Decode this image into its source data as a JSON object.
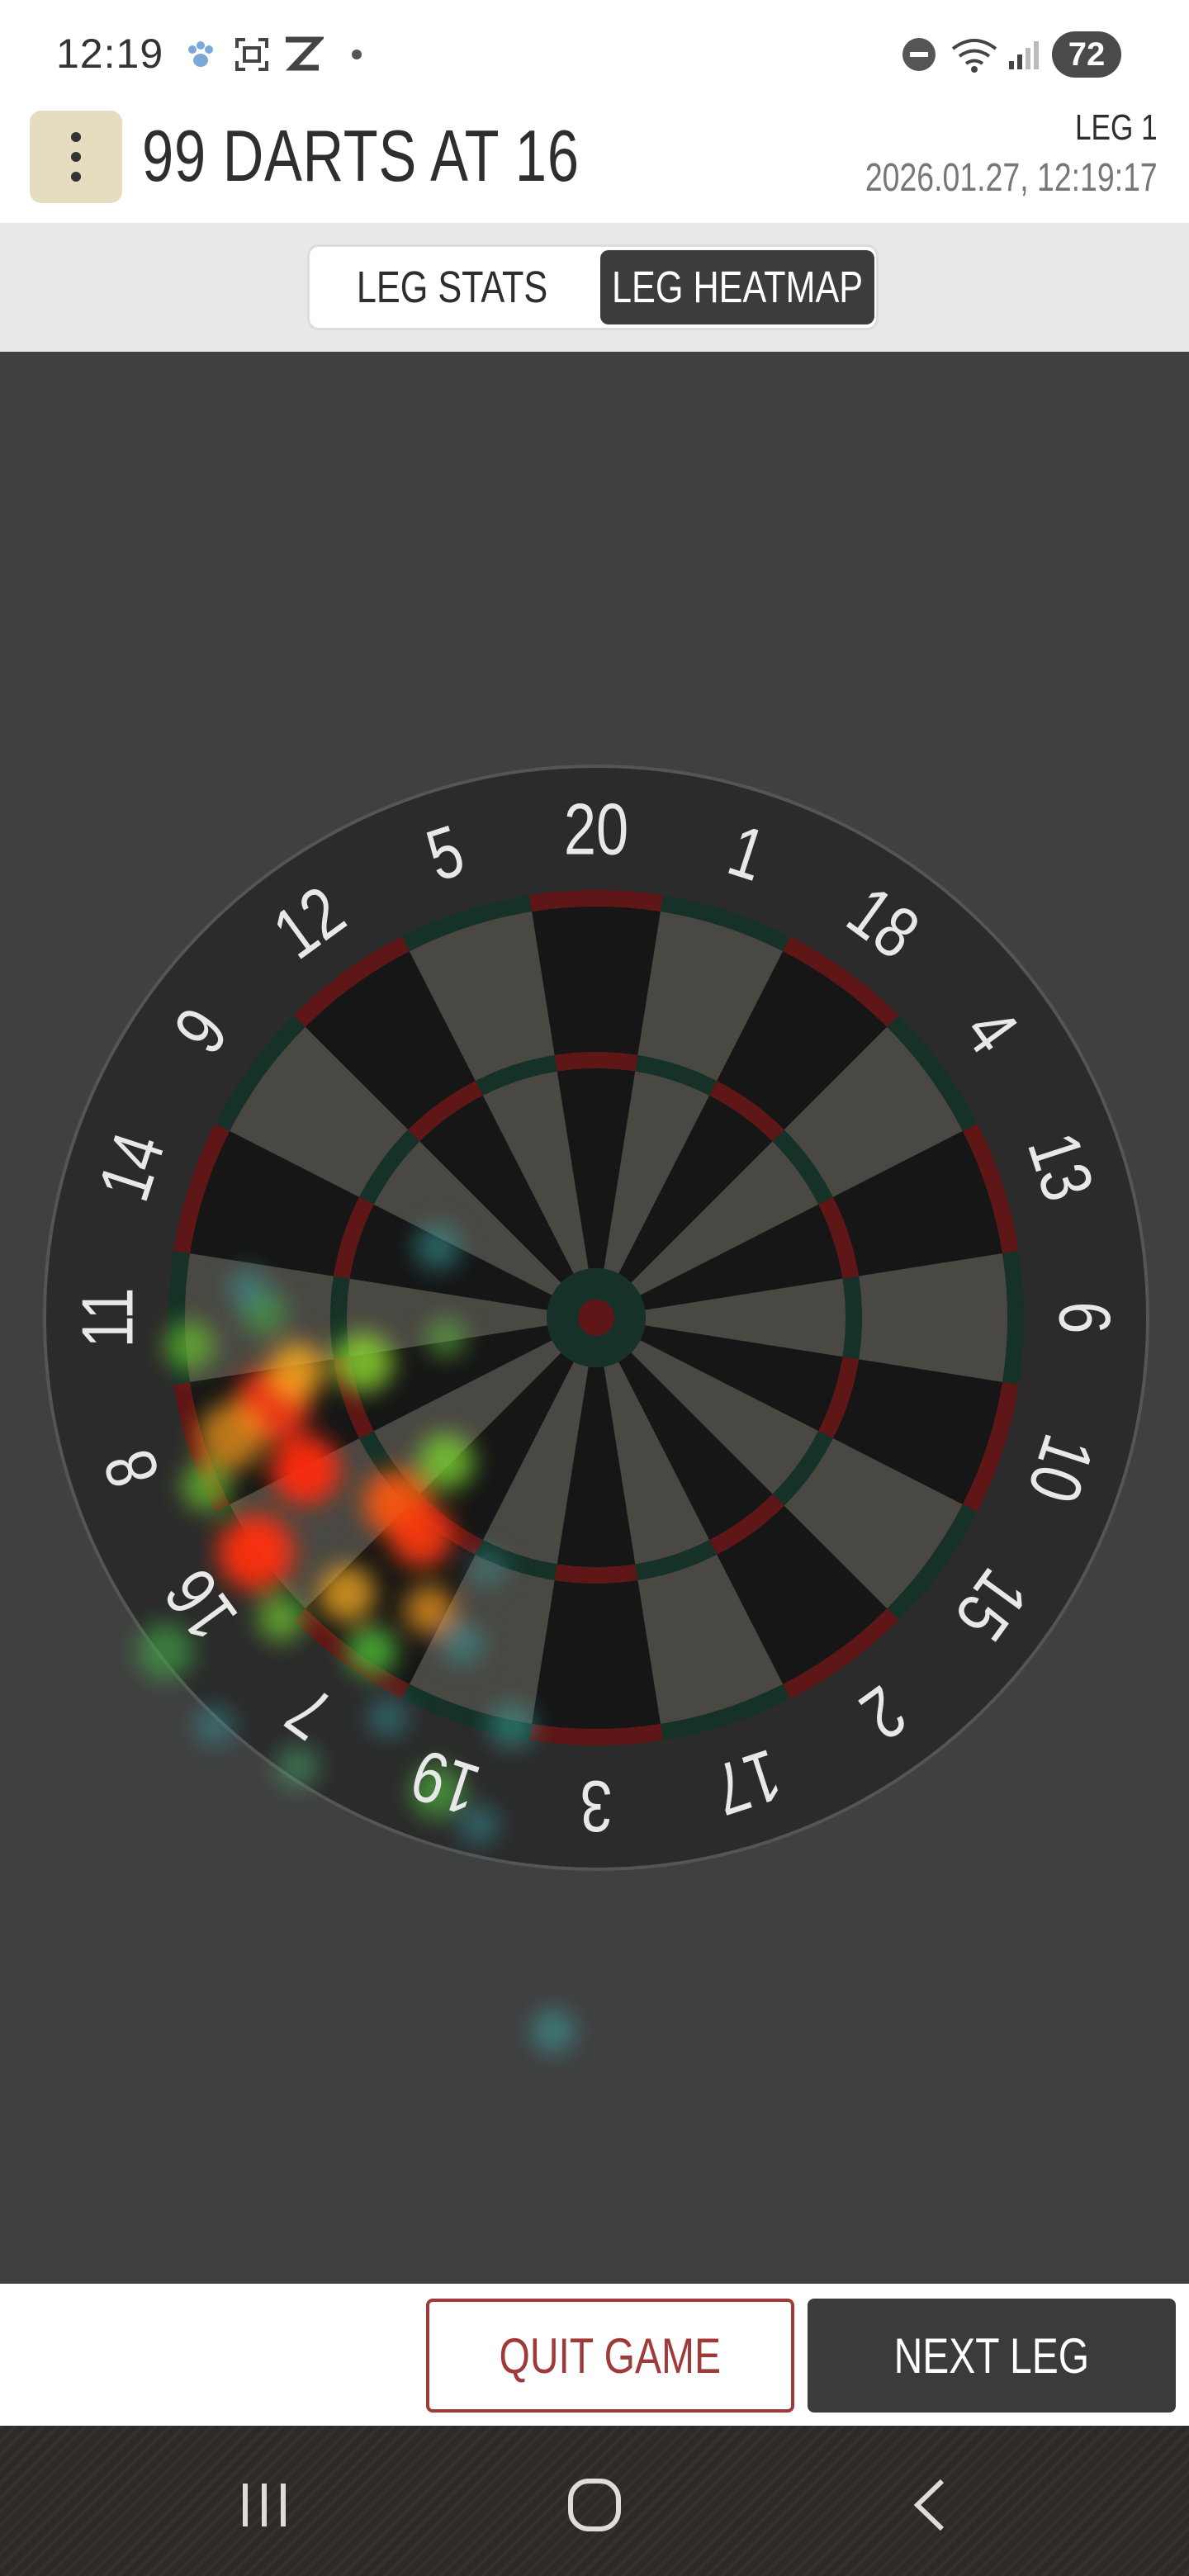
{
  "status_bar": {
    "time": "12:19",
    "battery": "72",
    "icons": [
      "paw-icon",
      "screenshot-icon",
      "z-app-icon",
      "notification-dot-icon",
      "do-not-disturb-icon",
      "wifi-icon",
      "signal-icon"
    ]
  },
  "header": {
    "title": "99 DARTS AT 16",
    "leg": "LEG 1",
    "datetime": "2026.01.27, 12:19:17"
  },
  "tabs": [
    {
      "label": "LEG STATS",
      "active": false
    },
    {
      "label": "LEG HEATMAP",
      "active": true
    }
  ],
  "dartboard": {
    "numbers": [
      "20",
      "1",
      "18",
      "4",
      "13",
      "6",
      "10",
      "15",
      "2",
      "17",
      "3",
      "19",
      "7",
      "16",
      "8",
      "11",
      "14",
      "9",
      "12",
      "5"
    ],
    "colors": {
      "dark_segment": "#161616",
      "light_segment": "#4a4843",
      "red_ring": "#5e1616",
      "green_ring": "#163228",
      "number_ring": "#2b2b2b",
      "number_text": "#e8e8e8"
    }
  },
  "footer": {
    "quit_label": "QUIT GAME",
    "next_label": "NEXT LEG"
  },
  "nav": {
    "icons": [
      "recent-apps-icon",
      "home-icon",
      "back-icon"
    ]
  }
}
